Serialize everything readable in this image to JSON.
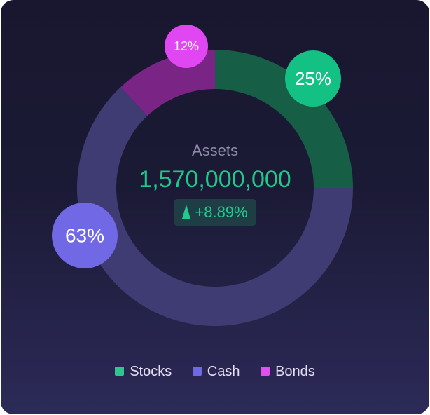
{
  "chart_data": {
    "type": "pie",
    "variant": "donut",
    "categories": [
      "Stocks",
      "Cash",
      "Bonds"
    ],
    "values": [
      25,
      63,
      12
    ],
    "labels": [
      "25%",
      "63%",
      "12%"
    ],
    "colors": {
      "Stocks": "#175e47",
      "Cash": "#3f3c74",
      "Bonds": "#7a2585"
    },
    "legend_colors": {
      "Stocks": "#30c58f",
      "Cash": "#6f6ae2",
      "Bonds": "#e050ee"
    },
    "label_bubble_colors": {
      "Stocks": "#14c184",
      "Cash": "#7168e6",
      "Bonds": "#e047f2"
    },
    "legend_position": "bottom",
    "center": {
      "title": "Assets",
      "value": "1,570,000,000",
      "change": "+8.89%",
      "change_direction": "up"
    }
  }
}
